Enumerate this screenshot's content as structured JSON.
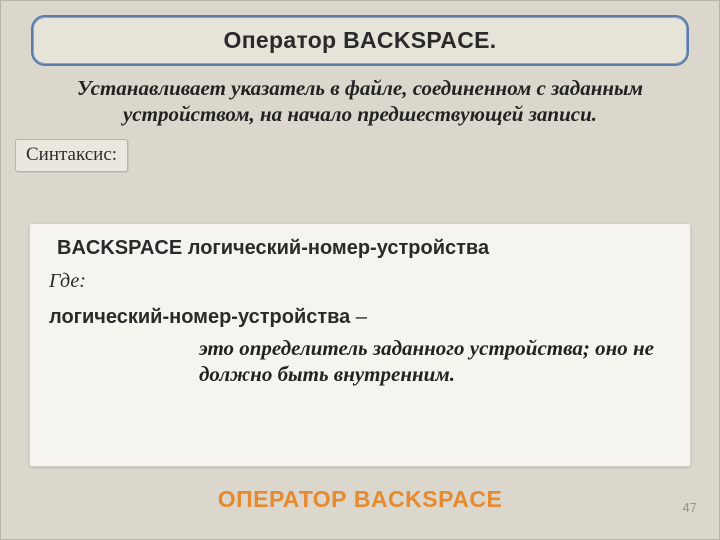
{
  "title": "Оператор BACKSPACE.",
  "description": "Устанавливает указатель в файле, соединенном с заданным устройством, на начало предшествующей записи.",
  "syntax_label": "Синтаксис:",
  "syntax_line": "BACKSPACE логический-номер-устройства",
  "where": "Где:",
  "param_name": "логический-номер-устройства",
  "dash": " –",
  "param_desc": "это определитель заданного устройства; оно не должно быть внутренним.",
  "footer_title": "ОПЕРАТОР BACKSPACE",
  "page_number": "47"
}
